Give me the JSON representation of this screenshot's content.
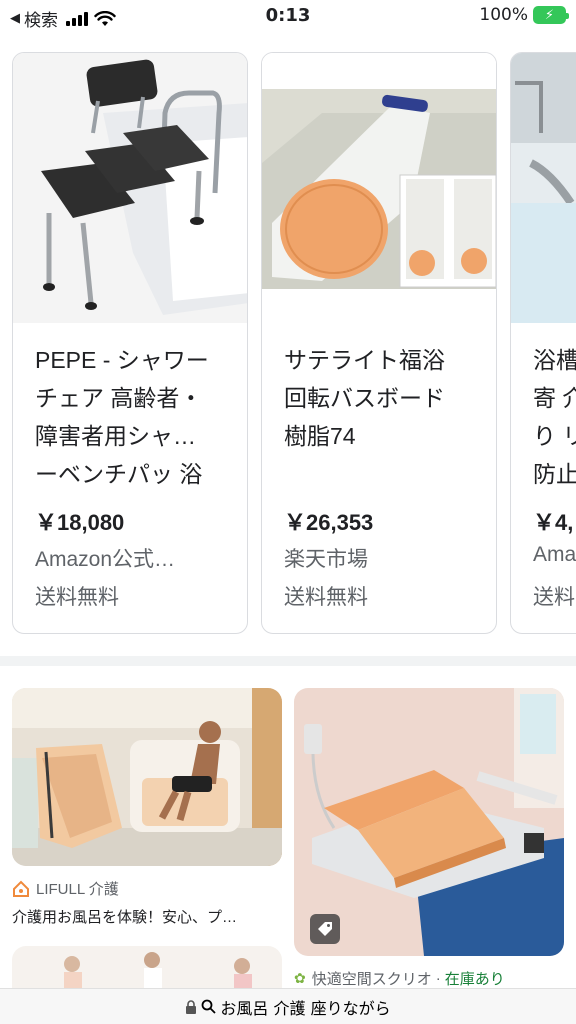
{
  "status": {
    "back_label": "検索",
    "time": "0:13",
    "battery_text": "100%"
  },
  "products": [
    {
      "title": "PEPE - シャワーチェア 高齢者・障害者用シャ…ーベンチパッ 浴",
      "title_lines": [
        "PEPE - シャワー",
        "チェア 高齢者・",
        "障害者用シャ…",
        "ーベンチパッ 浴"
      ],
      "price": "￥18,080",
      "seller": "Amazon公式…",
      "shipping": "送料無料"
    },
    {
      "title": "サテライト福浴回転バスボード樹脂74",
      "title_lines": [
        "サテライト福浴",
        "回転バスボード",
        "樹脂74"
      ],
      "price": "￥26,353",
      "seller": "楽天市場",
      "shipping": "送料無料"
    },
    {
      "title": "浴槽 寄 介 り リ 防止",
      "title_lines": [
        "浴槽",
        "寄 介",
        "り リ",
        "防止"
      ],
      "price": "￥4,",
      "seller": "Ama",
      "shipping": "送料"
    }
  ],
  "images": [
    {
      "source": "LIFULL 介護",
      "snippet": "介護用お風呂を体験！安心、プ…"
    },
    {
      "source": "快適空間スクリオ",
      "stock": "在庫あり",
      "separator": "·"
    }
  ],
  "url_bar": {
    "query": "お風呂 介護 座りながら"
  },
  "colors": {
    "accent_green": "#188038",
    "battery_green": "#34c759",
    "board_orange": "#f0a46a"
  }
}
